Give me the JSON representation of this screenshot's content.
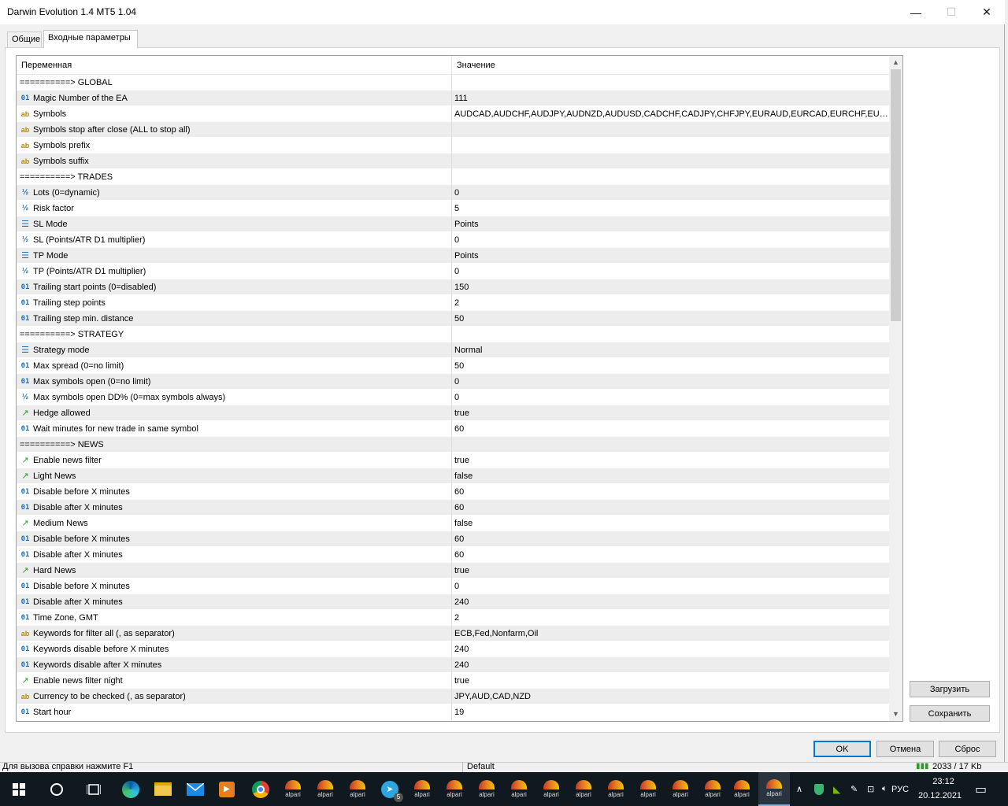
{
  "window": {
    "title": "Darwin Evolution 1.4 MT5 1.04",
    "minimize": "—",
    "maximize": "☐",
    "close": "✕"
  },
  "tabs": [
    {
      "label": "Общие",
      "active": false
    },
    {
      "label": "Входные параметры",
      "active": true
    }
  ],
  "grid": {
    "col_variable": "Переменная",
    "col_value": "Значение",
    "rows": [
      {
        "type": "section",
        "name": "==========> GLOBAL",
        "value": ""
      },
      {
        "type": "int",
        "name": "Magic Number of the EA",
        "value": "111"
      },
      {
        "type": "string",
        "name": "Symbols",
        "value": "AUDCAD,AUDCHF,AUDJPY,AUDNZD,AUDUSD,CADCHF,CADJPY,CHFJPY,EURAUD,EURCAD,EURCHF,EURGBP,E..."
      },
      {
        "type": "string",
        "name": "Symbols stop after close (ALL to stop all)",
        "value": ""
      },
      {
        "type": "string",
        "name": "Symbols prefix",
        "value": ""
      },
      {
        "type": "string",
        "name": "Symbols suffix",
        "value": ""
      },
      {
        "type": "section",
        "name": "==========> TRADES",
        "value": ""
      },
      {
        "type": "double",
        "name": "Lots (0=dynamic)",
        "value": "0"
      },
      {
        "type": "double",
        "name": "Risk factor",
        "value": "5"
      },
      {
        "type": "enum",
        "name": "SL Mode",
        "value": "Points"
      },
      {
        "type": "double",
        "name": "SL (Points/ATR D1 multiplier)",
        "value": "0"
      },
      {
        "type": "enum",
        "name": "TP Mode",
        "value": "Points"
      },
      {
        "type": "double",
        "name": "TP (Points/ATR D1 multiplier)",
        "value": "0"
      },
      {
        "type": "int",
        "name": "Trailing start points (0=disabled)",
        "value": "150"
      },
      {
        "type": "int",
        "name": "Trailing step points",
        "value": "2"
      },
      {
        "type": "int",
        "name": "Trailing step min. distance",
        "value": "50"
      },
      {
        "type": "section",
        "name": "==========> STRATEGY",
        "value": ""
      },
      {
        "type": "enum",
        "name": "Strategy mode",
        "value": "Normal"
      },
      {
        "type": "int",
        "name": "Max spread (0=no limit)",
        "value": "50"
      },
      {
        "type": "int",
        "name": "Max symbols open (0=no limit)",
        "value": "0"
      },
      {
        "type": "double",
        "name": "Max symbols open DD% (0=max symbols always)",
        "value": "0"
      },
      {
        "type": "bool",
        "name": "Hedge allowed",
        "value": "true"
      },
      {
        "type": "int",
        "name": "Wait minutes for new trade in same symbol",
        "value": "60"
      },
      {
        "type": "section",
        "name": "==========> NEWS",
        "value": ""
      },
      {
        "type": "bool",
        "name": "Enable news filter",
        "value": "true"
      },
      {
        "type": "bool",
        "name": "Light News",
        "value": "false"
      },
      {
        "type": "int",
        "name": "Disable before X minutes",
        "value": "60"
      },
      {
        "type": "int",
        "name": "Disable after X minutes",
        "value": "60"
      },
      {
        "type": "bool",
        "name": "Medium News",
        "value": "false"
      },
      {
        "type": "int",
        "name": "Disable before X minutes",
        "value": "60"
      },
      {
        "type": "int",
        "name": "Disable after X minutes",
        "value": "60"
      },
      {
        "type": "bool",
        "name": "Hard News",
        "value": "true"
      },
      {
        "type": "int",
        "name": "Disable before X minutes",
        "value": "0"
      },
      {
        "type": "int",
        "name": "Disable after X minutes",
        "value": "240"
      },
      {
        "type": "int",
        "name": "Time Zone, GMT",
        "value": "2"
      },
      {
        "type": "string",
        "name": "Keywords for filter all (, as separator)",
        "value": "ECB,Fed,Nonfarm,Oil"
      },
      {
        "type": "int",
        "name": "Keywords disable before X minutes",
        "value": "240"
      },
      {
        "type": "int",
        "name": "Keywords disable after X minutes",
        "value": "240"
      },
      {
        "type": "bool",
        "name": "Enable news filter night",
        "value": "true"
      },
      {
        "type": "string",
        "name": "Currency to be checked (, as separator)",
        "value": "JPY,AUD,CAD,NZD"
      },
      {
        "type": "int",
        "name": "Start hour",
        "value": "19"
      }
    ]
  },
  "icons": {
    "int": "01",
    "string": "ab",
    "double": "½",
    "enum": "☰",
    "bool": "↗"
  },
  "buttons": {
    "load": "Загрузить",
    "save": "Сохранить",
    "ok": "OK",
    "cancel": "Отмена",
    "reset": "Сброс"
  },
  "statusbar": {
    "help": "Для вызова справки нажмите F1",
    "profile": "Default",
    "traffic": "2033 / 17 Kb"
  },
  "taskbar": {
    "alpari_label": "alpari",
    "telegram_badge": "5",
    "lang": "РУС",
    "time": "23:12",
    "date": "20.12.2021"
  }
}
